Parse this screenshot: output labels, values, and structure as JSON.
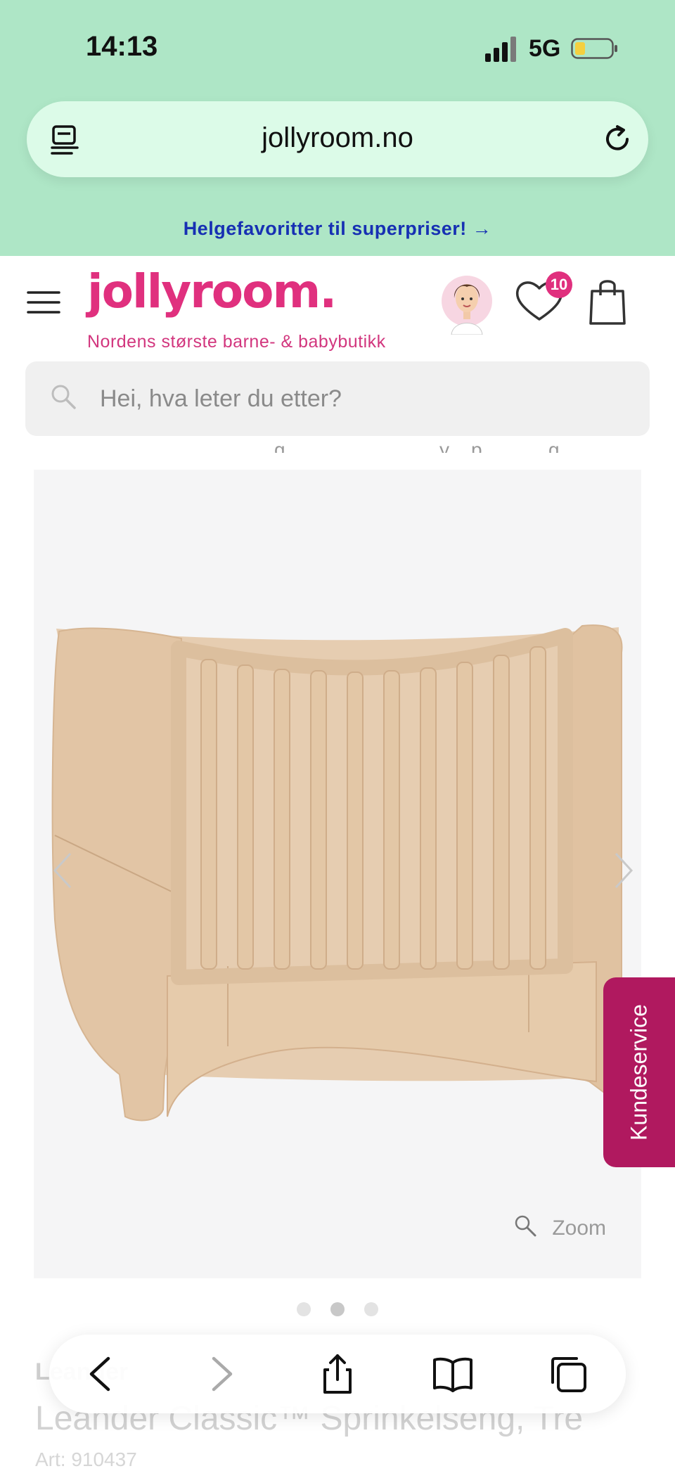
{
  "status_bar": {
    "time": "14:13",
    "network": "5G",
    "battery_color": "#f4d03f"
  },
  "browser": {
    "url": "jollyroom.no"
  },
  "promo_banner": {
    "text": "Helgefavoritter til superpriser! →"
  },
  "header": {
    "logo_text": "jollyroom.",
    "tagline": "Nordens største barne- & babybutikk",
    "wishlist_count": "10",
    "brand_color": "#e0307e"
  },
  "search": {
    "placeholder": "Hei, hva leter du etter?"
  },
  "gallery": {
    "zoom_label": "Zoom",
    "image_count": 3,
    "active_index": 2
  },
  "support": {
    "label": "Kundeservice",
    "color": "#b0195f"
  },
  "product": {
    "brand": "Leander",
    "title": "Leander Classic™ Sprinkelseng, Tre",
    "article": "Art: 910437"
  },
  "toolbar": {
    "icons": [
      "back-icon",
      "forward-icon",
      "share-icon",
      "bookmarks-icon",
      "tabs-icon"
    ]
  }
}
